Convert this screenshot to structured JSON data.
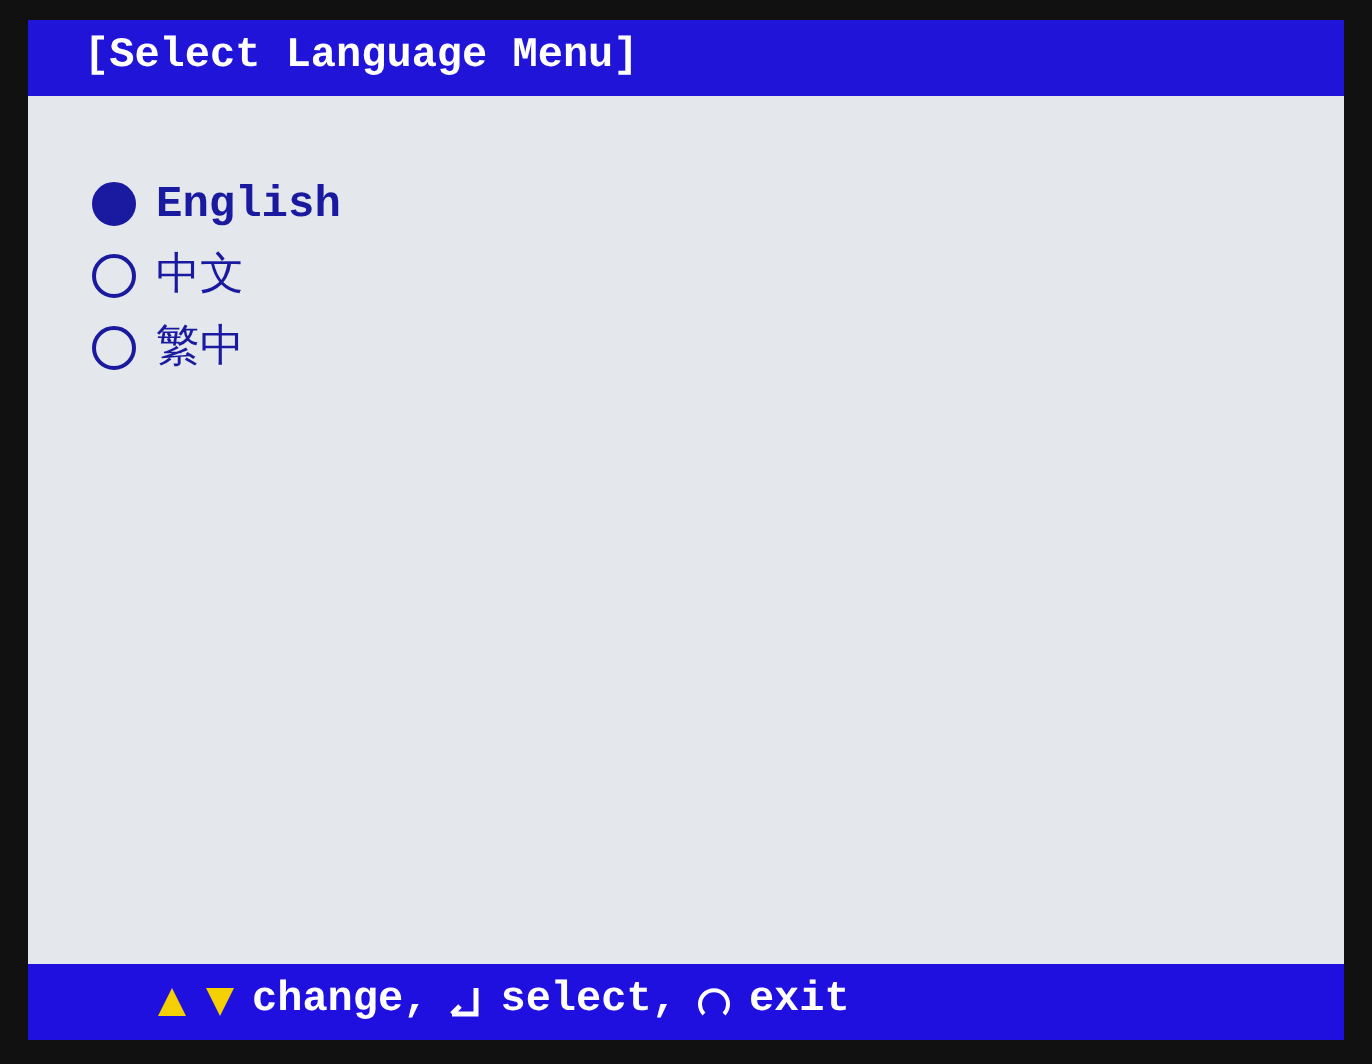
{
  "title": "[Select Language Menu]",
  "options": [
    {
      "label": "English",
      "selected": true
    },
    {
      "label": "中文",
      "selected": false
    },
    {
      "label": "繁中",
      "selected": false
    }
  ],
  "footer": [
    {
      "kind": "arrows",
      "label": "change,"
    },
    {
      "kind": "enter",
      "label": "select,"
    },
    {
      "kind": "back",
      "label": "exit"
    }
  ]
}
